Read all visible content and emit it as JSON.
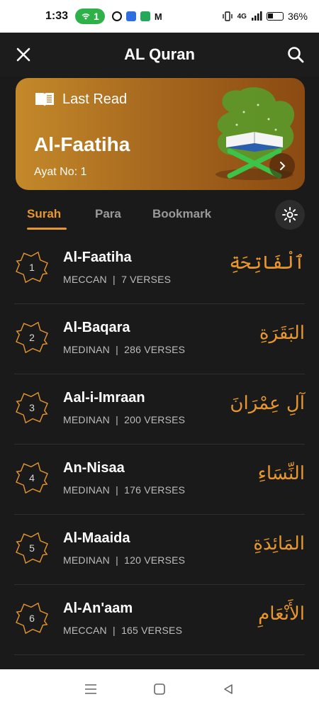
{
  "status_bar": {
    "time": "1:33",
    "hotspot_count": "1",
    "network": "4G",
    "battery": "36%"
  },
  "app_bar": {
    "title": "AL Quran",
    "close_icon": "close-icon",
    "search_icon": "search-icon"
  },
  "last_read": {
    "label": "Last Read",
    "surah_name": "Al-Faatiha",
    "ayat": "Ayat No: 1",
    "icon": "book-icon"
  },
  "tabs": [
    {
      "label": "Surah",
      "active": true
    },
    {
      "label": "Para",
      "active": false
    },
    {
      "label": "Bookmark",
      "active": false
    }
  ],
  "surahs": [
    {
      "number": "1",
      "name": "Al-Faatiha",
      "meta": "MECCAN  |  7 VERSES",
      "arabic": "ٱلْفَاتِحَةِ"
    },
    {
      "number": "2",
      "name": "Al-Baqara",
      "meta": "MEDINAN  |  286 VERSES",
      "arabic": "البَقَرَةِ"
    },
    {
      "number": "3",
      "name": "Aal-i-Imraan",
      "meta": "MEDINAN  |  200 VERSES",
      "arabic": "آلِ عِمْرَانَ"
    },
    {
      "number": "4",
      "name": "An-Nisaa",
      "meta": "MEDINAN  |  176 VERSES",
      "arabic": "النِّسَاءِ"
    },
    {
      "number": "5",
      "name": "Al-Maaida",
      "meta": "MEDINAN  |  120 VERSES",
      "arabic": "المَائِدَةِ"
    },
    {
      "number": "6",
      "name": "Al-An'aam",
      "meta": "MECCAN  |  165 VERSES",
      "arabic": "الأَنْعَامِ"
    }
  ],
  "colors": {
    "accent": "#e8972e",
    "background": "#1a1a1a",
    "card_start": "#c4892a",
    "card_end": "#8a4a12"
  }
}
